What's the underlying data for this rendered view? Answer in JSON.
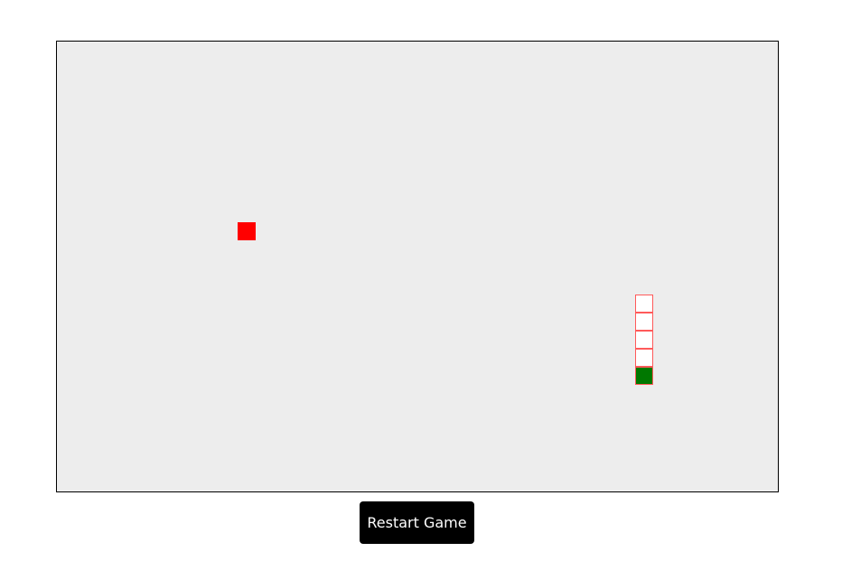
{
  "game": {
    "grid_cell_units": "cells",
    "food": {
      "col": 10,
      "row": 10
    },
    "snake": [
      {
        "col": 32,
        "row": 14
      },
      {
        "col": 32,
        "row": 15
      },
      {
        "col": 32,
        "row": 16
      },
      {
        "col": 32,
        "row": 17
      },
      {
        "col": 32,
        "row": 18
      }
    ],
    "colors": {
      "board": "#ededed",
      "food": "#ff0000",
      "snake_head": "#007800",
      "snake_body": "#ffffff",
      "snake_border": "#ff5a5a"
    }
  },
  "controls": {
    "restart_label": "Restart Game"
  }
}
